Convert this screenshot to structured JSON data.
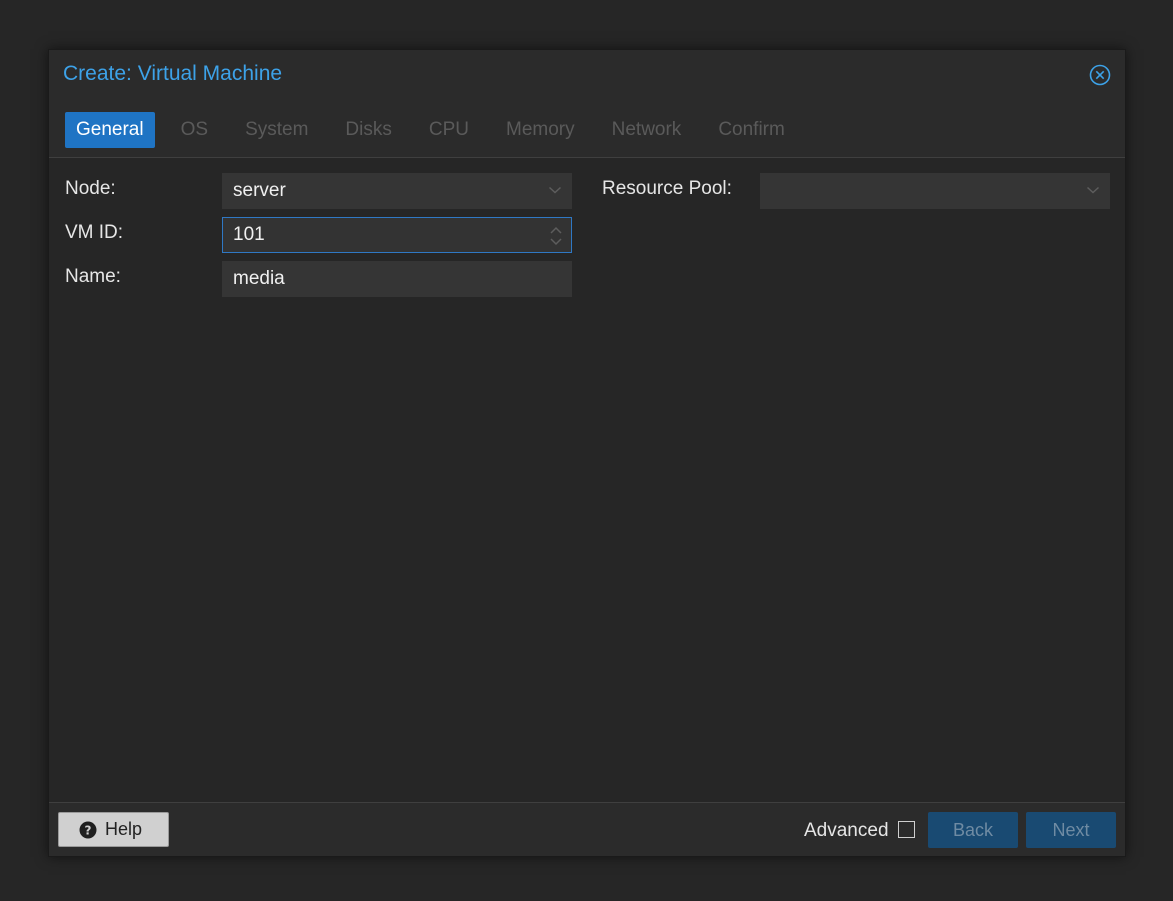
{
  "window": {
    "title": "Create: Virtual Machine"
  },
  "tabs": [
    {
      "label": "General",
      "active": true
    },
    {
      "label": "OS",
      "active": false
    },
    {
      "label": "System",
      "active": false
    },
    {
      "label": "Disks",
      "active": false
    },
    {
      "label": "CPU",
      "active": false
    },
    {
      "label": "Memory",
      "active": false
    },
    {
      "label": "Network",
      "active": false
    },
    {
      "label": "Confirm",
      "active": false
    }
  ],
  "form": {
    "node_label": "Node:",
    "node_value": "server",
    "vmid_label": "VM ID:",
    "vmid_value": "101",
    "name_label": "Name:",
    "name_value": "media",
    "pool_label": "Resource Pool:",
    "pool_value": ""
  },
  "footer": {
    "help_label": "Help",
    "advanced_label": "Advanced",
    "advanced_checked": false,
    "back_label": "Back",
    "next_label": "Next"
  },
  "colors": {
    "accent": "#3da2e8",
    "active_tab": "#1f74c4",
    "disabled_button": "#194a72"
  },
  "icons": {
    "close": "close-circle-icon",
    "help": "question-circle-icon",
    "dropdown": "chevron-down-icon",
    "spinner": "spinner-arrows-icon"
  }
}
